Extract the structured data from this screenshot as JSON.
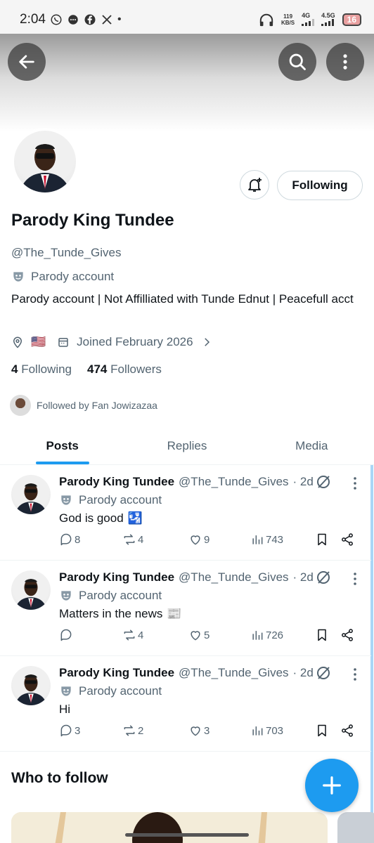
{
  "status_bar": {
    "time": "2:04",
    "notif_dot": "•",
    "speed_value": "119",
    "speed_unit": "KB/S",
    "net1": "4G",
    "net2": "4.5G",
    "battery": "16"
  },
  "profile": {
    "name": "Parody King Tundee",
    "handle": "@The_Tunde_Gives",
    "parody_label": "Parody account",
    "bio": "Parody account | Not Affilliated with Tunde Ednut | Peacefull acct",
    "location_flag": "🇺🇸",
    "joined": "Joined February 2026",
    "following_count": "4",
    "following_label": "Following",
    "followers_count": "474",
    "followers_label": "Followers",
    "followed_by": "Followed by Fan Jowizazaa",
    "follow_button": "Following"
  },
  "tabs": [
    {
      "label": "Posts",
      "active": true
    },
    {
      "label": "Replies",
      "active": false
    },
    {
      "label": "Media",
      "active": false
    }
  ],
  "posts": [
    {
      "name": "Parody King Tundee",
      "handle": "@The_Tunde_Gives",
      "time": "· 2d",
      "parody_label": "Parody account",
      "text": "God is good",
      "emoji": "🛂",
      "replies": "8",
      "reposts": "4",
      "likes": "9",
      "views": "743"
    },
    {
      "name": "Parody King Tundee",
      "handle": "@The_Tunde_Gives",
      "time": "· 2d",
      "parody_label": "Parody account",
      "text": "Matters in the news",
      "emoji": "📰",
      "replies": "",
      "reposts": "4",
      "likes": "5",
      "views": "726"
    },
    {
      "name": "Parody King Tundee",
      "handle": "@The_Tunde_Gives",
      "time": "· 2d",
      "parody_label": "Parody account",
      "text": "Hi",
      "emoji": "",
      "replies": "3",
      "reposts": "2",
      "likes": "3",
      "views": "703"
    }
  ],
  "who_to_follow": {
    "title": "Who to follow"
  },
  "icons": {
    "back": "arrow-left-icon",
    "search": "search-icon",
    "more": "more-vertical-icon",
    "notify": "bell-plus-icon",
    "compose": "plus-icon"
  },
  "colors": {
    "accent": "#1d9bf0",
    "text_primary": "#0f1419",
    "text_secondary": "#536471"
  }
}
